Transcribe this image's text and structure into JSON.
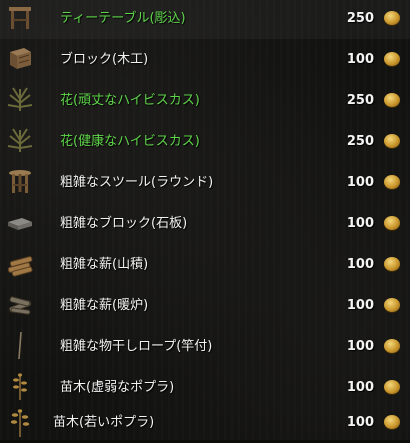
{
  "items": [
    {
      "icon": "tea-table-icon",
      "name": "ティーテーブル(彫込)",
      "price": "250",
      "color": "#5fd64a"
    },
    {
      "icon": "wood-block-icon",
      "name": "ブロック(木工)",
      "price": "100",
      "color": "#f2f2f2"
    },
    {
      "icon": "hibiscus-flower-icon",
      "name": "花(頑丈なハイビスカス)",
      "price": "250",
      "color": "#5fd64a"
    },
    {
      "icon": "hibiscus-flower-icon",
      "name": "花(健康なハイビスカス)",
      "price": "250",
      "color": "#5fd64a"
    },
    {
      "icon": "stool-icon",
      "name": "粗雑なスツール(ラウンド)",
      "price": "100",
      "color": "#f2f2f2"
    },
    {
      "icon": "stone-block-icon",
      "name": "粗雑なブロック(石板)",
      "price": "100",
      "color": "#f2f2f2"
    },
    {
      "icon": "firewood-pile-icon",
      "name": "粗雑な薪(山積)",
      "price": "100",
      "color": "#f2f2f2"
    },
    {
      "icon": "firewood-fireplace-icon",
      "name": "粗雑な薪(暖炉)",
      "price": "100",
      "color": "#f2f2f2"
    },
    {
      "icon": "pole-icon",
      "name": "粗雑な物干しロープ(竿付)",
      "price": "100",
      "color": "#f2f2f2"
    },
    {
      "icon": "sapling-icon",
      "name": "苗木(虚弱なポプラ)",
      "price": "100",
      "color": "#f2f2f2"
    },
    {
      "icon": "sapling-icon",
      "name": "苗木(若いポプラ)",
      "price": "100",
      "color": "#f2f2f2"
    }
  ],
  "currency_icon": "gold-coin-icon"
}
